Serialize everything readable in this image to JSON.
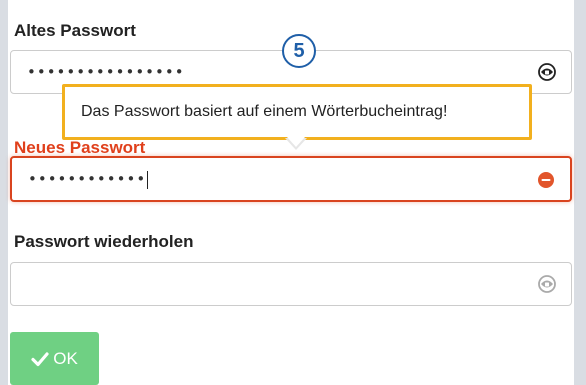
{
  "form": {
    "old_password": {
      "label": "Altes Passwort",
      "masked_value": "••••••••••••••••"
    },
    "new_password": {
      "label": "Neues Passwort",
      "masked_value": "••••••••••••"
    },
    "repeat_password": {
      "label": "Passwort wiederholen",
      "masked_value": ""
    },
    "ok_button": {
      "label": "OK",
      "icon": "checkmark-icon"
    }
  },
  "tooltip": {
    "text": "Das Passwort basiert auf einem Wörterbucheintrag!"
  },
  "step_badge": {
    "number": "5"
  },
  "colors": {
    "error": "#d9441f",
    "tooltip_border": "#f2b01e",
    "badge": "#1f5fa8",
    "ok_button": "#6fd083"
  },
  "icons": {
    "old_password_toggle": "eye-lock-icon",
    "new_password_status": "error-icon",
    "repeat_password_toggle": "eye-lock-icon"
  }
}
